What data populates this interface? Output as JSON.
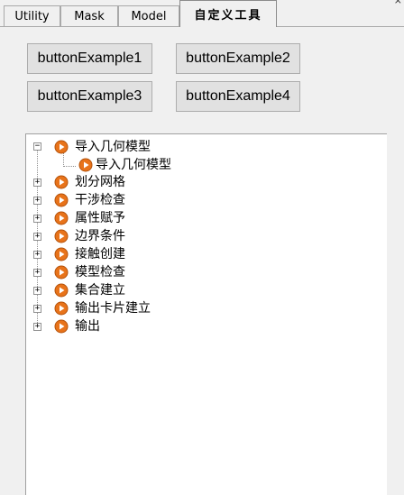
{
  "tabs": [
    {
      "label": "Utility"
    },
    {
      "label": "Mask"
    },
    {
      "label": "Model"
    },
    {
      "label": "自定义工具",
      "active": true
    }
  ],
  "corner_mark": "×",
  "buttons": [
    {
      "label": "buttonExample1"
    },
    {
      "label": "buttonExample2"
    },
    {
      "label": "buttonExample3"
    },
    {
      "label": "buttonExample4"
    }
  ],
  "tree": {
    "root": {
      "label": "导入几何模型",
      "expanded": true,
      "children": [
        {
          "label": "导入几何模型"
        }
      ]
    },
    "items": [
      {
        "label": "划分网格"
      },
      {
        "label": "干涉检查"
      },
      {
        "label": "属性赋予"
      },
      {
        "label": "边界条件"
      },
      {
        "label": "接触创建"
      },
      {
        "label": "模型检查"
      },
      {
        "label": "集合建立"
      },
      {
        "label": "输出卡片建立"
      },
      {
        "label": "输出"
      }
    ]
  },
  "colors": {
    "node_icon": "#e8731a",
    "node_icon_edge": "#b4520b"
  }
}
